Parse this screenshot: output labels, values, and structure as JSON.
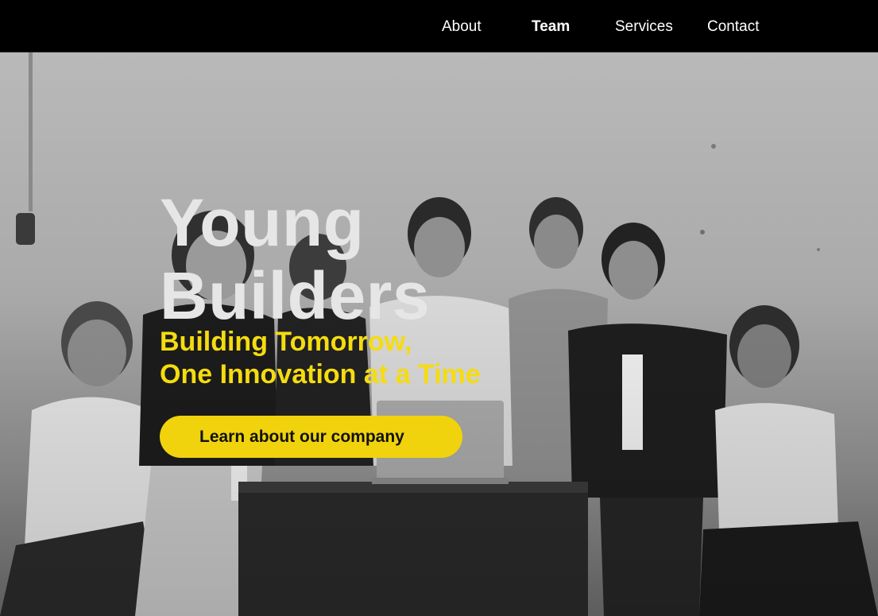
{
  "nav": {
    "items": [
      {
        "label": "About",
        "active": false
      },
      {
        "label": "Team",
        "active": true
      },
      {
        "label": "Services",
        "active": false
      },
      {
        "label": "Contact",
        "active": false
      }
    ]
  },
  "hero": {
    "title_line1": "Young",
    "title_line2": "Builders",
    "subtitle_line1": "Building Tomorrow,",
    "subtitle_line2": "One Innovation at a Time",
    "cta_label": "Learn about our company",
    "image": "grayscale group photo of seven young people around a laptop on a desk"
  },
  "colors": {
    "nav_background": "#000000",
    "title": "#e6e6e6",
    "accent_yellow": "#f5dc0f",
    "button_background": "#f0d30c",
    "button_text": "#111111"
  }
}
